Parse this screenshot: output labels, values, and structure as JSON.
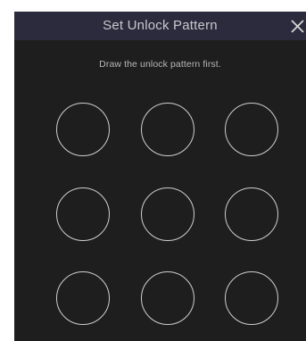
{
  "dialog": {
    "title": "Set Unlock Pattern",
    "close_icon": "close-icon",
    "instruction": "Draw the unlock pattern first."
  },
  "pattern_grid": {
    "rows": 3,
    "columns": 3,
    "points": [
      1,
      2,
      3,
      4,
      5,
      6,
      7,
      8,
      9
    ]
  },
  "colors": {
    "background": "#1e1e1e",
    "title_bar": "#2b2b3d",
    "circle_stroke": "#cfcfcf",
    "text": "#b8b8b8"
  }
}
